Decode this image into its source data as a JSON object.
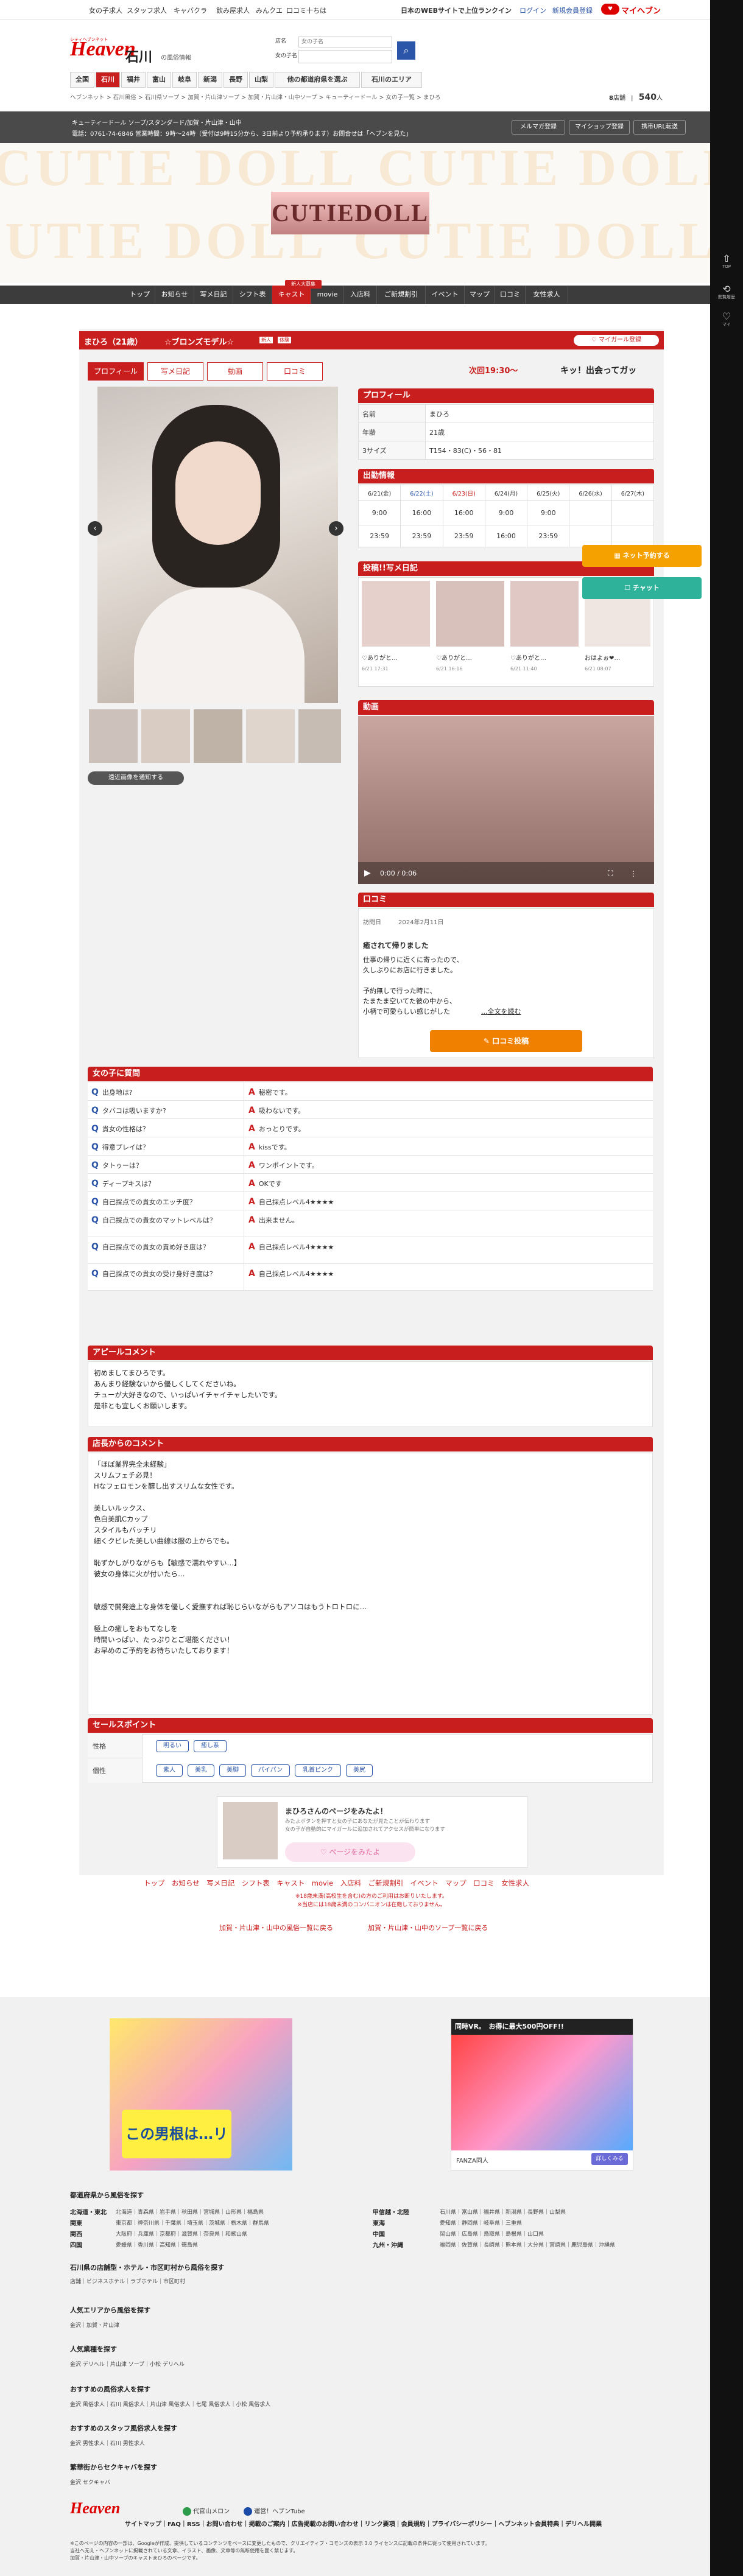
{
  "topbar": {
    "links": [
      "女の子求人",
      "スタッフ求人",
      "キャバクラ",
      "飲み屋求人",
      "みんクエ",
      "口コミ十ちは"
    ],
    "ranking": "日本のWEBサイトで上位ランクイン",
    "login": "ログイン",
    "signup": "新規会員登録",
    "mypage": "マイヘブン"
  },
  "header": {
    "logo": "Heaven",
    "logo_small": "シティヘブンネット",
    "area": "石川",
    "area_sub": "の風俗情報",
    "search_label": "店名",
    "search_placeholder": "女の子名",
    "search_label2": "女の子名"
  },
  "navtabs": [
    "全国",
    "石川",
    "福井",
    "富山",
    "岐阜",
    "新潟",
    "長野",
    "山梨",
    "他の都道府県を選ぶ",
    "石川のエリア"
  ],
  "breadcrumb": "ヘブンネット > 石川風俗 > 石川県ソープ > 加賀・片山津ソープ > 加賀・片山津・山中ソープ > キューティードール > 女の子一覧 > まひろ",
  "stats": {
    "count1": "8",
    "unit1": "店舗",
    "count2": "540",
    "unit2": "人"
  },
  "store": {
    "line1": "キューティードール ソープ/スタンダード/加賀・片山津・山中",
    "line2": "電話：0761-74-6846 営業時間：9時〜24時（受付は9時15分から、3日前より予約承ります）お問合せは「ヘブンを見た」",
    "btn1": "メルマガ登録",
    "btn2": "マイショップ登録",
    "btn3": "携帯URL転送"
  },
  "banner": {
    "bg": "CUTIE DOLL",
    "logo": "CUTIEDOLL"
  },
  "storenav": [
    "トップ",
    "お知らせ",
    "写メ日記",
    "シフト表",
    "キャスト",
    "movie",
    "入店料",
    "ご新規割引",
    "イベント",
    "マップ",
    "口コミ",
    "女性求人"
  ],
  "storenav_badge": "新人大募集",
  "girl": {
    "name": "まひろ（21歳）",
    "rank": "☆ブロンズモデル☆",
    "badge1": "新人",
    "badge2": "体験",
    "mygirl": "マイガール登録",
    "next": "次回19:30〜",
    "catch": "キッ！出会ってガッ"
  },
  "tabs": [
    "プロフィール",
    "写メ日記",
    "動画",
    "口コミ"
  ],
  "photo": {
    "button": "遠近画像を通知する"
  },
  "profile": {
    "title": "プロフィール",
    "rows": [
      {
        "k": "名前",
        "v": "まひろ"
      },
      {
        "k": "年齢",
        "v": "21歳"
      },
      {
        "k": "3サイズ",
        "v": "T154・83(C)・56・81"
      }
    ]
  },
  "schedule": {
    "title": "出勤情報",
    "days": [
      "6/21(金)",
      "6/22(土)",
      "6/23(日)",
      "6/24(月)",
      "6/25(火)",
      "6/26(水)",
      "6/27(木)"
    ],
    "start": [
      "9:00",
      "16:00",
      "16:00",
      "9:00",
      "9:00",
      "",
      ""
    ],
    "end": [
      "23:59",
      "23:59",
      "23:59",
      "16:00",
      "23:59",
      "",
      ""
    ]
  },
  "diary": {
    "title": "投稿!!写メ日記",
    "items": [
      {
        "t": "♡ありがと…",
        "d": "6/21 17:31"
      },
      {
        "t": "♡ありがと…",
        "d": "6/21 16:16"
      },
      {
        "t": "♡ありがと…",
        "d": "6/21 11:40"
      },
      {
        "t": "おはよぉ❤…",
        "d": "6/21 08:07"
      }
    ]
  },
  "float": {
    "reserve": "ネット予約する",
    "chat": "チャット"
  },
  "video": {
    "title": "動画",
    "time": "0:00 / 0:06"
  },
  "review": {
    "title": "口コミ",
    "date_label": "訪問日",
    "date": "2024年2月11日",
    "heading": "癒されて帰りました",
    "body": "仕事の帰りに近くに寄ったので、\n久しぶりにお店に行きました。\n\n予約無しで行った時に、\nたまたま空いてた彼の中から、\n小柄で可愛らしい感じがした",
    "more": "...全文を読む",
    "button": "口コミ投稿"
  },
  "qa": {
    "title": "女の子に質問",
    "rows": [
      {
        "q": "出身地は?",
        "a": "秘密です。"
      },
      {
        "q": "タバコは吸いますか?",
        "a": "吸わないです。"
      },
      {
        "q": "貴女の性格は？",
        "a": "おっとりです。"
      },
      {
        "q": "得意プレイは？",
        "a": "kissです。"
      },
      {
        "q": "タトゥーは？",
        "a": "ワンポイントです。"
      },
      {
        "q": "ディープキスは？",
        "a": "OKです"
      },
      {
        "q": "自己採点での貴女のエッチ度？",
        "a": "自己採点レベル4★★★★"
      },
      {
        "q": "自己採点での貴女のマットレベルは？",
        "a": "出来ません。"
      },
      {
        "q": "自己採点での貴女の責め好き度は？",
        "a": "自己採点レベル4★★★★"
      },
      {
        "q": "自己採点での貴女の受け身好き度は？",
        "a": "自己採点レベル4★★★★"
      }
    ]
  },
  "appeal": {
    "title": "アピールコメント",
    "body": "初めましてまひろです。\nあんまり経験ないから優しくしてくださいね。\nチューが大好きなので、いっぱいイチャイチャしたいです。\n是非とも宜しくお願いします。"
  },
  "shop": {
    "title": "店長からのコメント",
    "body": "「ほぼ業界完全未経験」\nスリムフェチ必見！\nHなフェロモンを醸し出すスリムな女性です。\n\n美しいルックス、\n色白美肌Cカップ\nスタイルもバッチリ\n細くクビレた美しい曲線は服の上からでも。\n\n恥ずかしがりながらも【敏感で濡れやすい…】\n彼女の身体に火が付いたら…\n\n\n敏感で開発途上な身体を優しく愛撫すれば恥じらいながらもアソコはもうトロトロに…\n\n極上の癒しをおもてなしを\n時間いっぱい、たっぷりとご堪能ください！\nお早めのご予約をお待ちいたしております！"
  },
  "sales": {
    "title": "セールスポイント",
    "k1": "性格",
    "tags1": [
      "明るい",
      "癒し系"
    ],
    "k2": "個性",
    "tags2": [
      "素人",
      "美乳",
      "美脚",
      "パイパン",
      "乳首ピンク",
      "美尻"
    ]
  },
  "share": {
    "title": "まひろさんのページをみたよ！",
    "desc": "みたよボタンを押すと女の子にあなたが見たことが伝わります\n女の子が自動的にマイガールに追加されてアクセスが簡単になります",
    "button": "ページをみたよ"
  },
  "bottomnav": [
    "トップ",
    "お知らせ",
    "写メ日記",
    "シフト表",
    "キャスト",
    "movie",
    "入店料",
    "ご新規割引",
    "イベント",
    "マップ",
    "口コミ",
    "女性求人"
  ],
  "notice": "※18歳未満(高校生を含む)の方のご利用はお断りいたします。\n※当店には18歳未満のコンパニオンは在籍しておりません。",
  "bottomlinks": [
    "加賀・片山津・山中の風俗一覧に戻る",
    "加賀・片山津・山中のソープ一覧に戻る"
  ],
  "ad": {
    "title": "同時VR。　お得に最大500円OFF!!",
    "fanza": "FANZA同人",
    "more": "詳しくみる",
    "left": "この男根は…リアル"
  },
  "footer": {
    "h1": "都道府県から風俗を探す",
    "regions": [
      {
        "r": "北海道・東北",
        "p": "北海道｜青森県｜岩手県｜秋田県｜宮城県｜山形県｜福島県"
      },
      {
        "r": "関東",
        "p": "東京都｜神奈川県｜千葉県｜埼玉県｜茨城県｜栃木県｜群馬県"
      },
      {
        "r": "関西",
        "p": "大阪府｜兵庫県｜京都府｜滋賀県｜奈良県｜和歌山県"
      },
      {
        "r": "四国",
        "p": "愛媛県｜香川県｜高知県｜徳島県"
      },
      {
        "r": "甲信越・北陸",
        "p": "石川県｜富山県｜福井県｜新潟県｜長野県｜山梨県"
      },
      {
        "r": "東海",
        "p": "愛知県｜静岡県｜岐阜県｜三重県"
      },
      {
        "r": "中国",
        "p": "岡山県｜広島県｜鳥取県｜島根県｜山口県"
      },
      {
        "r": "九州・沖縄",
        "p": "福岡県｜佐賀県｜長崎県｜熊本県｜大分県｜宮崎県｜鹿児島県｜沖縄県"
      }
    ],
    "h2": "石川県の店舗型・ホテル・市区町村から風俗を探す",
    "l2": "店舗｜ビジネスホテル｜ラブホテル｜市区町村",
    "h3": "人気エリアから風俗を探す",
    "l3": "金沢｜加賀・片山津",
    "h4": "人気業種を探す",
    "l4": "金沢 デリヘル｜片山津 ソープ｜小松 デリヘル",
    "h5": "おすすめの風俗求人を探す",
    "l5": "金沢 風俗求人｜石川 風俗求人｜片山津 風俗求人｜七尾 風俗求人｜小松 風俗求人",
    "h6": "おすすめのスタッフ風俗求人を探す",
    "l6": "金沢 男性求人｜石川 男性求人",
    "h7": "繁華街からセクキャバを探す",
    "l7": "金沢 セクキャバ",
    "logo": "Heaven",
    "partner1": "代官山メロン",
    "partner2": "運営！ヘブンTube",
    "links": "サイトマップ｜FAQ｜RSS｜お問い合わせ｜掲載のご案内｜広告掲載のお問い合わせ｜リンク要項｜会員規約｜プライバシーポリシー｜ヘブンネット会員特典｜デリヘル開業",
    "copy": "※このページの内容の一部は、Googleが作成、提供しているコンテンツをベースに変更したもので、クリエイティブ・コモンズの表示 3.0 ライセンスに記載の条件に従って使用されています。\n当社へ无え・ヘブンネットに掲載されている文章、イラスト、画像、文章等の無断使用を固く禁じます。\n加賀・片山津・山中ソープのキャストまひろのページです。"
  },
  "rightbar": {
    "top": "TOP",
    "history": "閲覧履歴",
    "mypage": "マイ"
  }
}
